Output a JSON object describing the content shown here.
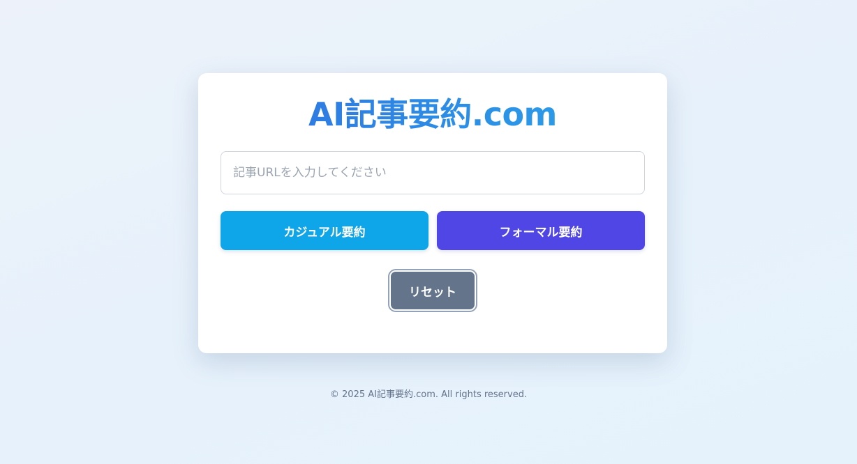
{
  "app": {
    "title": "AI記事要約.com"
  },
  "form": {
    "url_placeholder": "記事URLを入力してください",
    "url_value": ""
  },
  "buttons": {
    "casual_label": "カジュアル要約",
    "formal_label": "フォーマル要約",
    "reset_label": "リセット"
  },
  "footer": {
    "text": "© 2025 AI記事要約.com. All rights reserved."
  },
  "colors": {
    "title_gradient_start": "#2f6fe0",
    "title_gradient_end": "#2aa7ea",
    "casual_button": "#0ea5e9",
    "formal_button": "#4f46e5",
    "reset_button": "#64748b",
    "page_background": "#e8f1fb",
    "footer_text": "#64748b"
  }
}
